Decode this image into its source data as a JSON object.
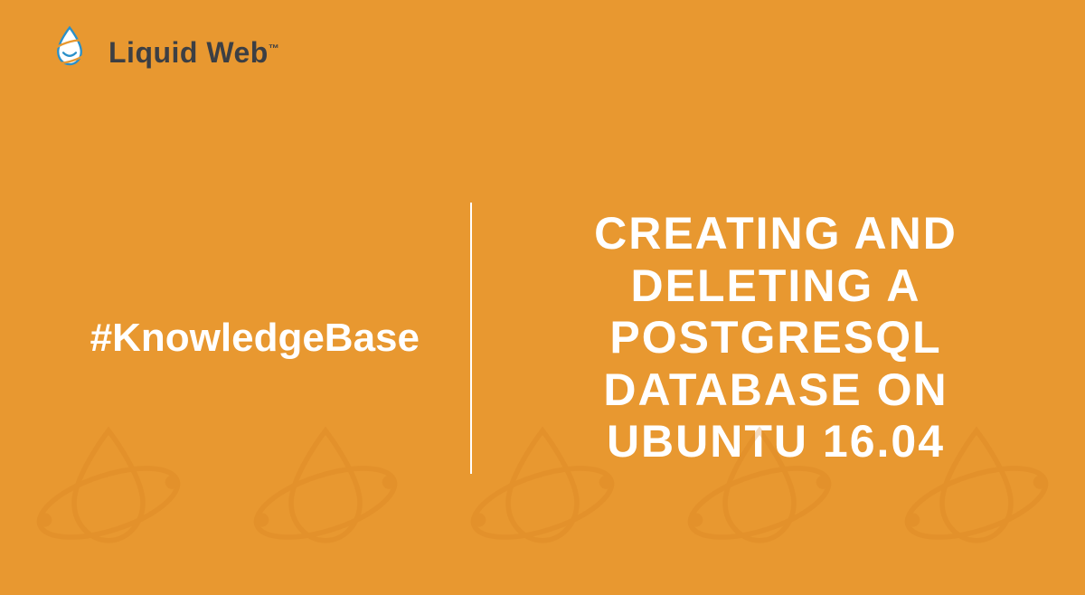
{
  "brand": {
    "name": "Liquid Web",
    "trademark": "™"
  },
  "hashtag": "#KnowledgeBase",
  "article_title": "CREATING AND DELETING A POSTGRESQL DATABASE ON UBUNTU 16.04"
}
